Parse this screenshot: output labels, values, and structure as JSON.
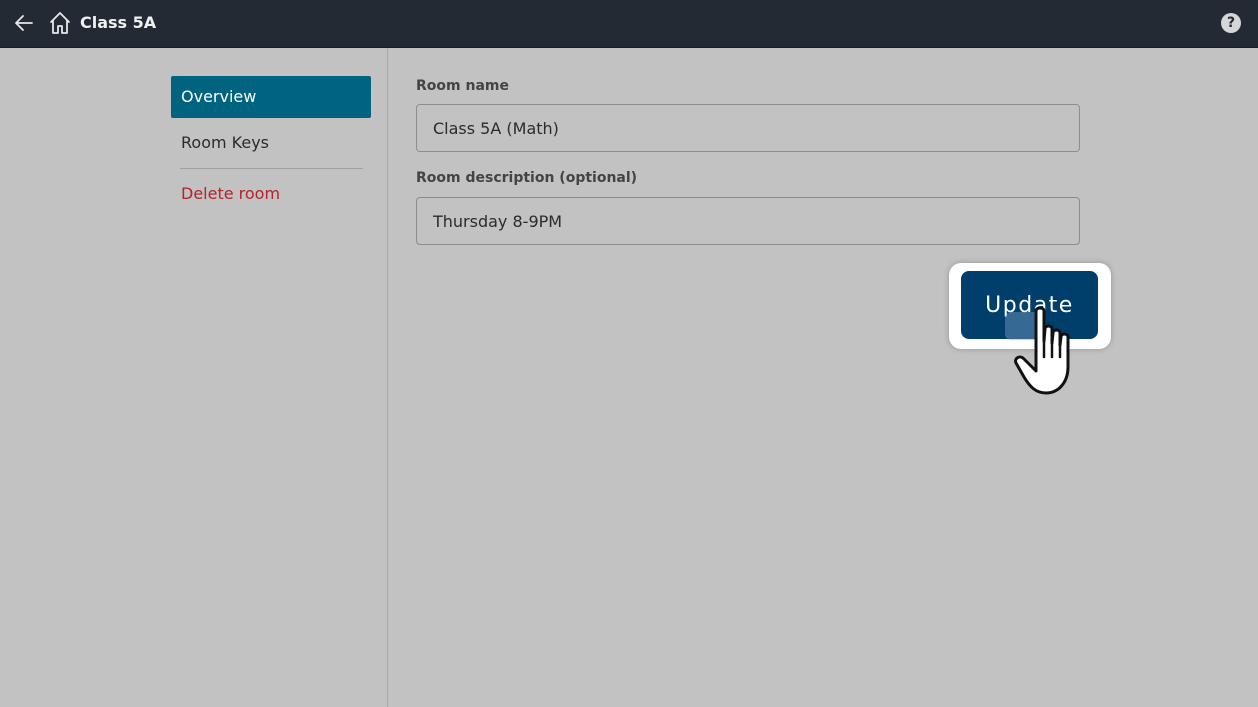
{
  "header": {
    "title": "Class 5A",
    "back_icon": "arrow-left-icon",
    "home_icon": "home-icon",
    "help_icon": "help-icon",
    "help_glyph": "?"
  },
  "sidebar": {
    "items": [
      {
        "label": "Overview",
        "active": true
      },
      {
        "label": "Room Keys",
        "active": false
      },
      {
        "label": "Delete room",
        "active": false,
        "color": "#b3232a"
      }
    ]
  },
  "form": {
    "room_name_label": "Room name",
    "room_name_value": "Class 5A (Math)",
    "room_description_label": "Room description (optional)",
    "room_description_value": "Thursday 8-9PM",
    "update_label": "Update"
  },
  "colors": {
    "topbar": "#232a33",
    "active_nav": "#00637f",
    "button": "#003e6b",
    "danger": "#b3232a",
    "background": "#c2c2c2"
  },
  "cursor": {
    "icon": "hand-pointer-icon"
  }
}
